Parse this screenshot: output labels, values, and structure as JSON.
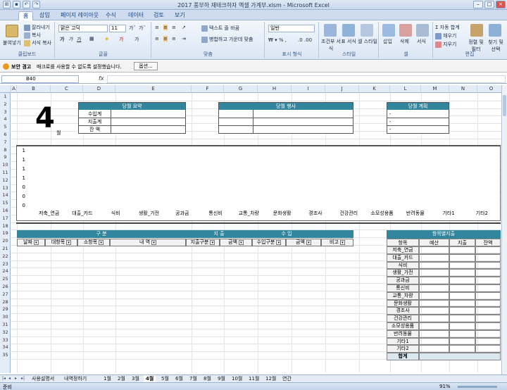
{
  "window": {
    "title": "2017 풍부하 재테크하자 엑셀 가계부.xlsm - Microsoft Excel"
  },
  "ribbon_tabs": [
    "홈",
    "삽입",
    "페이지 레이아웃",
    "수식",
    "데이터",
    "검토",
    "보기"
  ],
  "ribbon": {
    "paste": "붙여넣기",
    "cut": "잘라내기",
    "copy": "복사",
    "format_painter": "서식 복사",
    "font_name": "맑은 고딕",
    "font_size": "11",
    "wrap_text": "텍스트 줄 바꿈",
    "merge_center": "병합하고 가운데 맞춤",
    "number_format": "일반",
    "cond_format": "조건부 서식",
    "table_format": "표 서식",
    "cell_style": "셀 스타일",
    "insert": "삽입",
    "delete": "삭제",
    "format": "서식",
    "autosum": "자동 합계",
    "fill": "채우기",
    "clear": "지우기",
    "sort_filter": "정렬 및 필터",
    "find_select": "찾기 및 선택",
    "groups": [
      "클립보드",
      "글꼴",
      "맞춤",
      "표시 형식",
      "스타일",
      "셀",
      "편집"
    ]
  },
  "security": {
    "label": "보안 경고",
    "message": "매크로를 사용할 수 없도록 설정했습니다.",
    "options": "옵션..."
  },
  "formula_bar": {
    "name_box": "B40",
    "fx": "fx"
  },
  "columns": [
    "A",
    "B",
    "C",
    "D",
    "E",
    "F",
    "G",
    "H",
    "I",
    "J",
    "K",
    "L",
    "M",
    "N",
    "O"
  ],
  "rows": [
    "1",
    "2",
    "3",
    "4",
    "5",
    "6",
    "7",
    "8",
    "9",
    "10",
    "11",
    "12",
    "13",
    "14",
    "15",
    "16",
    "17",
    "18",
    "19",
    "20",
    "21",
    "22",
    "23",
    "24",
    "25",
    "26",
    "27",
    "28",
    "29",
    "30",
    "31",
    "32",
    "33",
    "34",
    "35"
  ],
  "sheet": {
    "month_number": "4",
    "month_label": "월",
    "summary": {
      "title": "당월 요약",
      "rows": [
        "수입계",
        "지출계",
        "잔    액"
      ]
    },
    "events": {
      "title": "당월 행사"
    },
    "plans": {
      "title": "당월 계획",
      "rows": [
        "-",
        "-",
        "-"
      ]
    },
    "ledger": {
      "group_headers": [
        "구  분",
        "지  출",
        "수  입"
      ],
      "columns": [
        "날짜",
        "대항목",
        "소항목",
        "내    역",
        "지출구분",
        "금액",
        "수입구분",
        "금액",
        "비고"
      ]
    },
    "by_item": {
      "title": "항목별지출",
      "columns": [
        "항목",
        "예산",
        "지출",
        "잔액"
      ],
      "items": [
        "저축_연금",
        "대출_카드",
        "식비",
        "생활_가전",
        "공과금",
        "통신비",
        "교통_차량",
        "문화생활",
        "경조사",
        "건강관리",
        "소모성용품",
        "반려동물",
        "기타1",
        "기타2"
      ],
      "total": "합계"
    }
  },
  "chart_data": {
    "type": "bar",
    "categories": [
      "저축_연금",
      "대출_카드",
      "식비",
      "생활_가전",
      "공과금",
      "통신비",
      "교통_차량",
      "문화생활",
      "경조사",
      "건강관리",
      "소모성용품",
      "반려동물",
      "기타1",
      "기타2"
    ],
    "values": [
      0,
      0,
      0,
      0,
      0,
      0,
      0,
      0,
      0,
      0,
      0,
      0,
      0,
      0
    ],
    "yticks": [
      "1",
      "1",
      "1",
      "1",
      "0",
      "0",
      "0"
    ],
    "title": "",
    "xlabel": "",
    "ylabel": "",
    "grid": false,
    "legend": "none"
  },
  "sheet_tabs": [
    "사용설명서",
    "내역정하기",
    "1월",
    "2월",
    "3월",
    "4월",
    "5월",
    "6월",
    "7월",
    "8월",
    "9월",
    "10월",
    "11월",
    "12월",
    "연간"
  ],
  "active_sheet": "4월",
  "status": {
    "ready": "준비",
    "zoom": "91%"
  }
}
